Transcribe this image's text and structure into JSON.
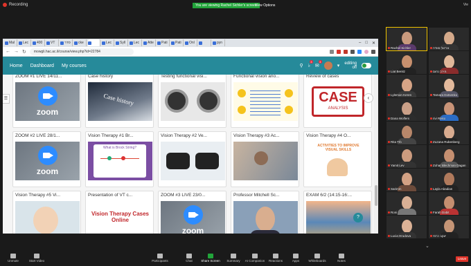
{
  "zoom_top": {
    "recording": "Recording",
    "share_banner": "You are viewing Rachel Sichler's screen",
    "view_options": "View Options",
    "right_text": "Vie"
  },
  "browser": {
    "tabs": [
      "Mal",
      "Lec",
      "400",
      "VT",
      "סדר",
      "cke",
      "",
      "Lec",
      "Syll",
      "Lec",
      "Atte",
      "Pati",
      "Pati",
      "Onl",
      "",
      "pyn"
    ],
    "url": "mowgli.hac.ac.il/course/view.php?id=22784"
  },
  "moodle": {
    "nav": [
      "Home",
      "Dashboard",
      "My courses"
    ],
    "notif_count": "3",
    "msg_count": "3",
    "editing_label": "editing",
    "editing_state": "off"
  },
  "cards": [
    {
      "title": "ZOOM #1 LIVE 14/11...",
      "image": "zoom"
    },
    {
      "title": "Case history",
      "image": "case-history"
    },
    {
      "title": "Testing functional visi...",
      "image": "phoropter"
    },
    {
      "title": "Functional vision ano...",
      "image": "diagram"
    },
    {
      "title": "Review of cases",
      "image": "case-analysis"
    },
    {
      "title": "ZOOM #2 LIVE 28/1...",
      "image": "zoom"
    },
    {
      "title": "Vision Therapy #1 Br...",
      "image": "brock-string"
    },
    {
      "title": "Vision Therapy #2 Ve...",
      "image": "glasses"
    },
    {
      "title": "Vision Therapy #3 Ac...",
      "image": "therapy"
    },
    {
      "title": "Vision Therapy #4 O...",
      "image": "activities"
    },
    {
      "title": "Vision Therapy #5 Vi...",
      "image": "child"
    },
    {
      "title": "Presentation of VT c...",
      "image": "vt-cases"
    },
    {
      "title": "ZOOM #3 LIVE 23/0...",
      "image": "zoom"
    },
    {
      "title": "Professor Mitchell Sc...",
      "image": "portrait"
    },
    {
      "title": "EXAM 6/2 (14:15-16:...",
      "image": "beach"
    }
  ],
  "card_text": {
    "zoom": "zoom",
    "case_history": "Case history",
    "case": "CASE",
    "analysis": "ANALYSIS",
    "brock": "What is Brock String?",
    "vt_cases_1": "Vision Therapy Cases",
    "vt_cases_2": "Online",
    "activities": "ACTIVITIES TO IMPROVE VISUAL SKILLS"
  },
  "participants": [
    {
      "name": "Rachel Sichler",
      "face": "#c99a7d",
      "shirt": "#5b3a6b"
    },
    {
      "name": "אריאל סוודה",
      "face": "#d4a98a",
      "shirt": "#333"
    },
    {
      "name": "Liat Benitz",
      "face": "#c8906e",
      "shirt": "#222"
    },
    {
      "name": "מירב נחום",
      "face": "#e0b89a",
      "shirt": "#8a2c2c"
    },
    {
      "name": "Lylemon Keren",
      "face": "#d6a486",
      "shirt": "#3a3a3a"
    },
    {
      "name": "Tamara Dotsenko",
      "face": "#e2b99c",
      "shirt": "#556"
    },
    {
      "name": "Dana Wolfers",
      "face": "#caa088",
      "shirt": "#2c2c2c"
    },
    {
      "name": "rivi Rikko",
      "face": "#c99478",
      "shirt": "#2b6cc4"
    },
    {
      "name": "Rita Trb",
      "face": "#b8876a",
      "shirt": "#444"
    },
    {
      "name": "Zuzana Rubenberg",
      "face": "#d8ab8f",
      "shirt": "#222"
    },
    {
      "name": "Yamit Lev",
      "face": "#cc9c7f",
      "shirt": "#333"
    },
    {
      "name": "Zohar Blechman Dagan",
      "face": "#c58f70",
      "shirt": "#555"
    },
    {
      "name": "Sarimm",
      "face": "#d2a184",
      "shirt": "#6b4a3a"
    },
    {
      "name": "Layla Abadian",
      "face": "#b07a5c",
      "shirt": "#222"
    },
    {
      "name": "Roni",
      "face": "#d9b095",
      "shirt": "#777"
    },
    {
      "name": "Farah Dabit",
      "face": "#c48e70",
      "shirt": "#b33"
    },
    {
      "name": "Lucia Hrudova",
      "face": "#dcb296",
      "shirt": "#333"
    },
    {
      "name": "יעקב כרמי",
      "face": "#c59576",
      "shirt": "#222"
    }
  ],
  "toolbar": {
    "unmute": "Unmute",
    "start_video": "Start Video",
    "participants": "Participants",
    "participants_count": "23",
    "chat": "Chat",
    "share_screen": "Share Screen",
    "summary": "Summary",
    "ai_companion": "AI Companion",
    "reactions": "Reactions",
    "apps": "Apps",
    "whiteboards": "Whiteboards",
    "notes": "Notes",
    "leave": "Leave"
  }
}
